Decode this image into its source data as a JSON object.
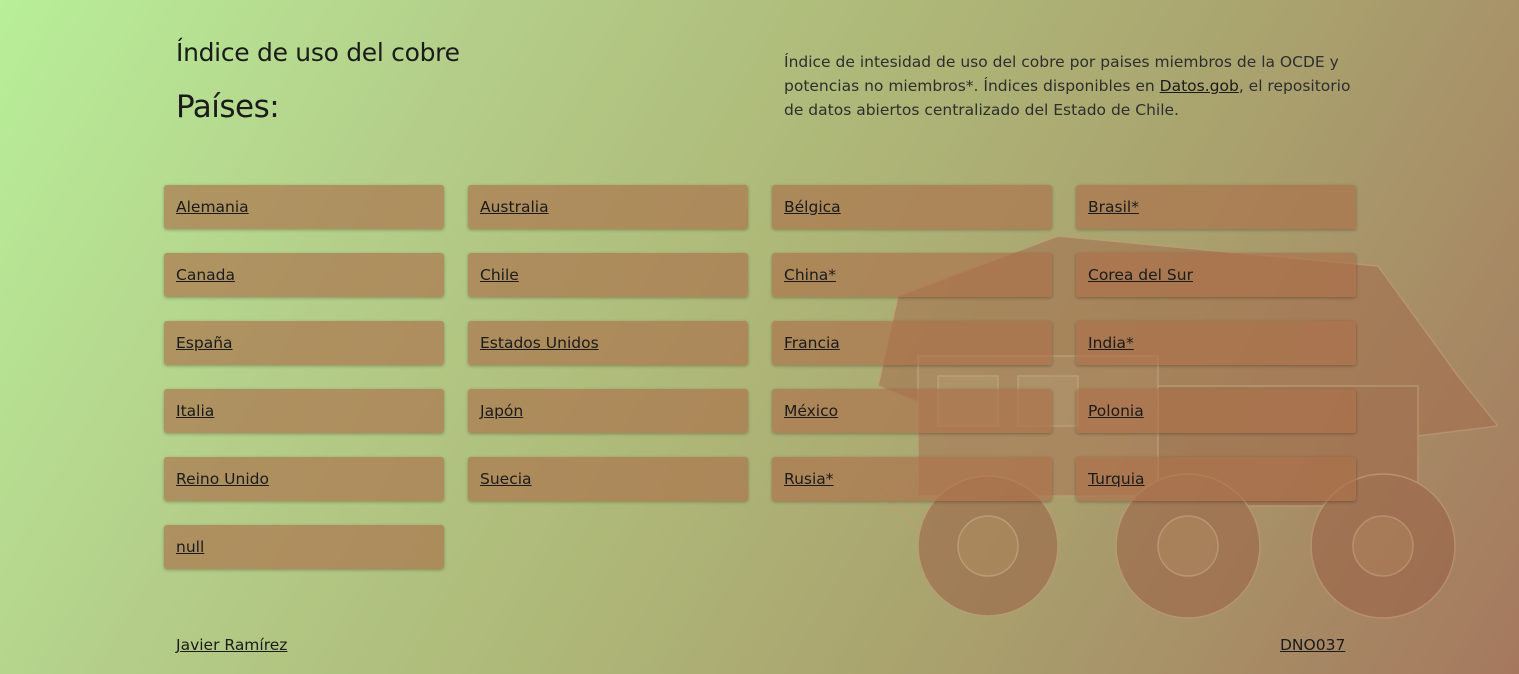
{
  "header": {
    "title": "Índice de uso del cobre",
    "subtitle": "Países:"
  },
  "description": {
    "text_before_link": "Índice de intesidad de uso del cobre por paises miembros de la OCDE y potencias no miembros*. Índices disponibles en ",
    "link_label": "Datos.gob",
    "text_after_link": ", el repositorio de datos abiertos centralizado del Estado de Chile."
  },
  "countries": [
    "Alemania",
    "Australia",
    "Bélgica",
    "Brasil*",
    "Canada",
    "Chile",
    "China*",
    "Corea del Sur",
    "España",
    "Estados Unidos",
    "Francia",
    "India*",
    "Italia",
    "Japón",
    "México",
    "Polonia",
    "Reino Unido",
    "Suecia",
    "Rusia*",
    "Turquia",
    "null"
  ],
  "footer": {
    "author": "Javier Ramírez",
    "code": "DNO037"
  },
  "colors": {
    "card_background": "#ac704a",
    "gradient_start": "#b8ef98",
    "gradient_end": "#a5785e"
  },
  "background_image": "mining-truck"
}
